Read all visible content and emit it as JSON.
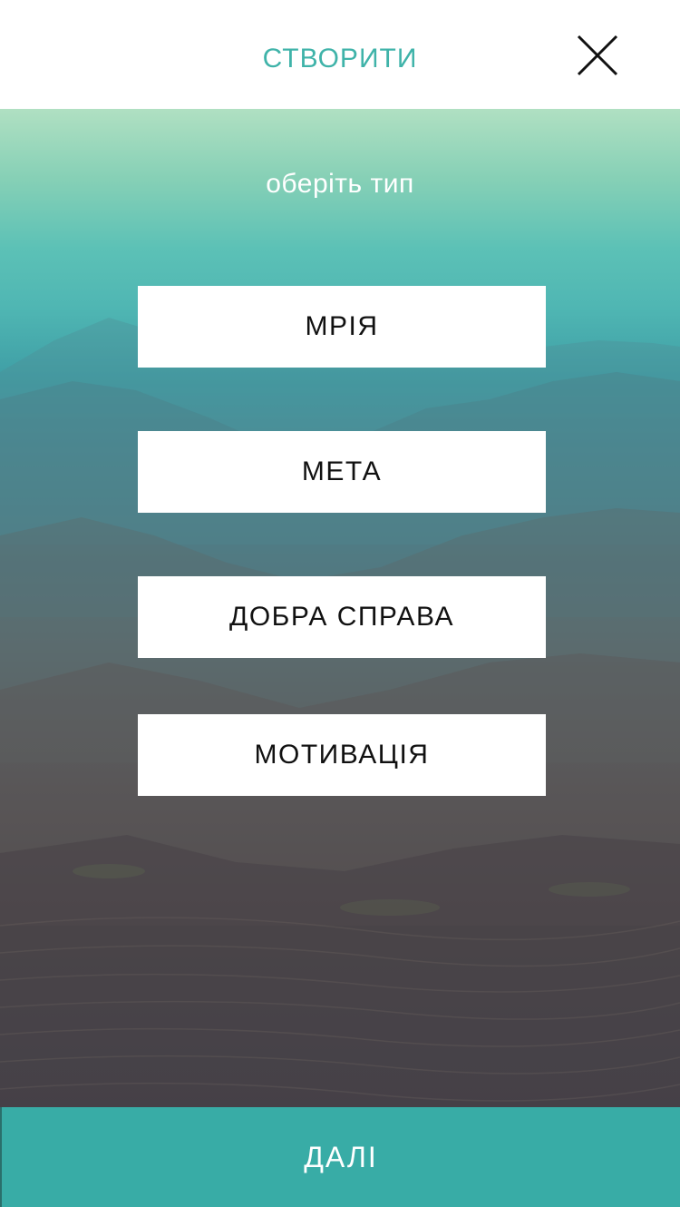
{
  "header": {
    "title": "СТВОРИТИ",
    "close_icon": "close-icon"
  },
  "main": {
    "subtitle": "оберіть тип",
    "types": [
      {
        "label": "МРІЯ"
      },
      {
        "label": "МЕТА"
      },
      {
        "label": "ДОБРА СПРАВА"
      },
      {
        "label": "МОТИВАЦІЯ"
      }
    ]
  },
  "footer": {
    "next_label": "ДАЛІ"
  },
  "colors": {
    "accent": "#3fb3a9",
    "footer_bg": "#38aca6",
    "button_bg": "#ffffff"
  }
}
